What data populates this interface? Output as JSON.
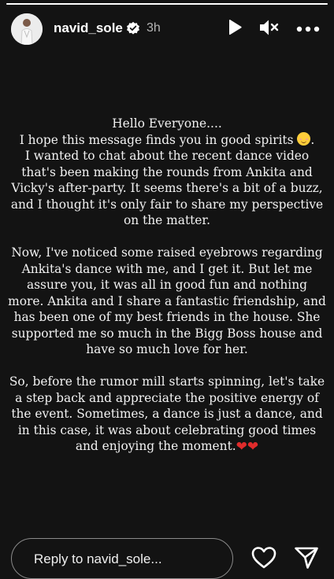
{
  "header": {
    "username": "navid_sole",
    "time": "3h",
    "verified": true,
    "icons": {
      "avatar": "profile-avatar",
      "verified": "verified-badge-icon",
      "play": "play-icon",
      "mute": "speaker-muted-icon",
      "more": "more-options-icon"
    }
  },
  "story": {
    "progress": 1.0,
    "paragraphs": [
      {
        "before_emoji": "Hello Everyone....\nI hope this message finds you in good spirits ",
        "emoji": "smiling-face-emoji",
        "after_emoji": ".\nI wanted to chat about the recent dance video that's been making the rounds from Ankita and Vicky's after-party. It seems there's a bit of a buzz, and I thought it's only fair to share my perspective on the matter."
      },
      {
        "text": "Now, I've noticed some raised eyebrows regarding Ankita's dance with me, and I get it. But let me assure you, it was all in good fun and nothing more. Ankita and I share a fantastic friendship, and has been one of my best friends in the house. She supported me so much in the Bigg Boss house and have so much love for her."
      },
      {
        "text": "So, before the rumor mill starts spinning, let's take a step back and appreciate the positive energy of the event. Sometimes, a dance is just a dance, and in this case, it was about celebrating good times and enjoying the moment.",
        "hearts": [
          "❤",
          "❤"
        ]
      }
    ]
  },
  "footer": {
    "reply_placeholder": "Reply to navid_sole...",
    "icons": {
      "like": "heart-outline-icon",
      "share": "send-icon"
    }
  },
  "colors": {
    "background": "#000000",
    "story_background": "#131313",
    "text": "#f2f2f2",
    "heart": "#e02b2b",
    "verified": "#ffffff"
  }
}
